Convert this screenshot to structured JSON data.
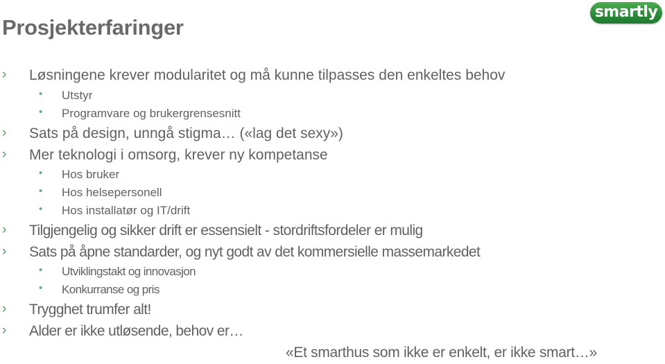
{
  "slide": {
    "title": "Prosjekterfaringer",
    "logo_text": "smartly",
    "colors": {
      "accent": "#4a9a5a",
      "logo_green": "#2e8b3a",
      "text": "#616161"
    },
    "bullets": [
      {
        "level": 1,
        "marker": "›",
        "text": "Løsningene krever modularitet og må kunne tilpasses den enkeltes behov"
      },
      {
        "level": 2,
        "marker": "•",
        "text": "Utstyr"
      },
      {
        "level": 2,
        "marker": "•",
        "text": "Programvare og brukergrensesnitt"
      },
      {
        "level": 1,
        "marker": "›",
        "text": "Sats på design, unngå stigma… («lag det sexy»)"
      },
      {
        "level": 1,
        "marker": "›",
        "text": "Mer teknologi i omsorg, krever ny kompetanse"
      },
      {
        "level": 2,
        "marker": "•",
        "text": "Hos bruker"
      },
      {
        "level": 2,
        "marker": "•",
        "text": "Hos helsepersonell"
      },
      {
        "level": 2,
        "marker": "•",
        "text": "Hos installatør og IT/drift"
      },
      {
        "level": 1,
        "marker": "›",
        "text": "Tilgjengelig og sikker drift er essensielt - stordriftsfordeler er mulig"
      },
      {
        "level": 1,
        "marker": "›",
        "text": "Sats på åpne standarder, og nyt godt av det kommersielle massemarkedet"
      },
      {
        "level": 2,
        "marker": "•",
        "text": "Utviklingstakt og innovasjon"
      },
      {
        "level": 2,
        "marker": "•",
        "text": "Konkurranse og pris"
      },
      {
        "level": 1,
        "marker": "›",
        "text": "Trygghet trumfer alt!"
      },
      {
        "level": 1,
        "marker": "›",
        "text": "Alder er ikke utløsende, behov er…"
      }
    ],
    "quote": "«Et smarthus som ikke er enkelt, er ikke smart…»"
  }
}
